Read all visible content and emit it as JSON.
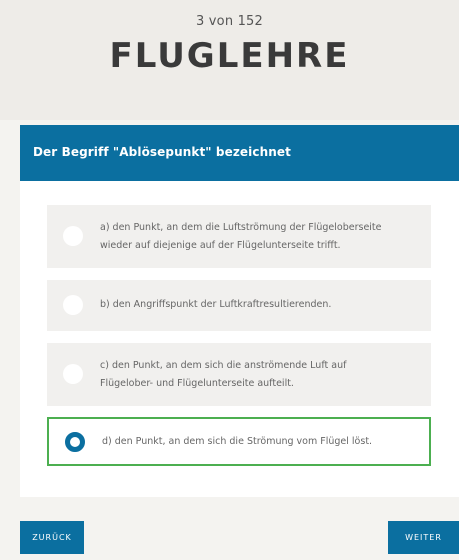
{
  "header": {
    "progress": "3 von 152",
    "title": "FLUGLEHRE"
  },
  "question": {
    "text": "Der Begriff \"Ablösepunkt\" bezeichnet"
  },
  "answers": [
    {
      "label": "a) den Punkt, an dem die Luftströmung der Flügeloberseite wieder auf diejenige auf der Flügelunterseite trifft.",
      "selected": false
    },
    {
      "label": "b) den Angriffspunkt der Luftkraftresultierenden.",
      "selected": false
    },
    {
      "label": "c) den Punkt, an dem sich die anströmende Luft auf Flügelober- und Flügelunterseite aufteilt.",
      "selected": false
    },
    {
      "label": "d) den Punkt, an dem sich die Strömung vom Flügel löst.",
      "selected": true
    }
  ],
  "navigation": {
    "back_label": "ZURÜCK",
    "next_label": "WEITER"
  },
  "colors": {
    "accent": "#0b6fa0",
    "selected_border": "#4caf50"
  }
}
